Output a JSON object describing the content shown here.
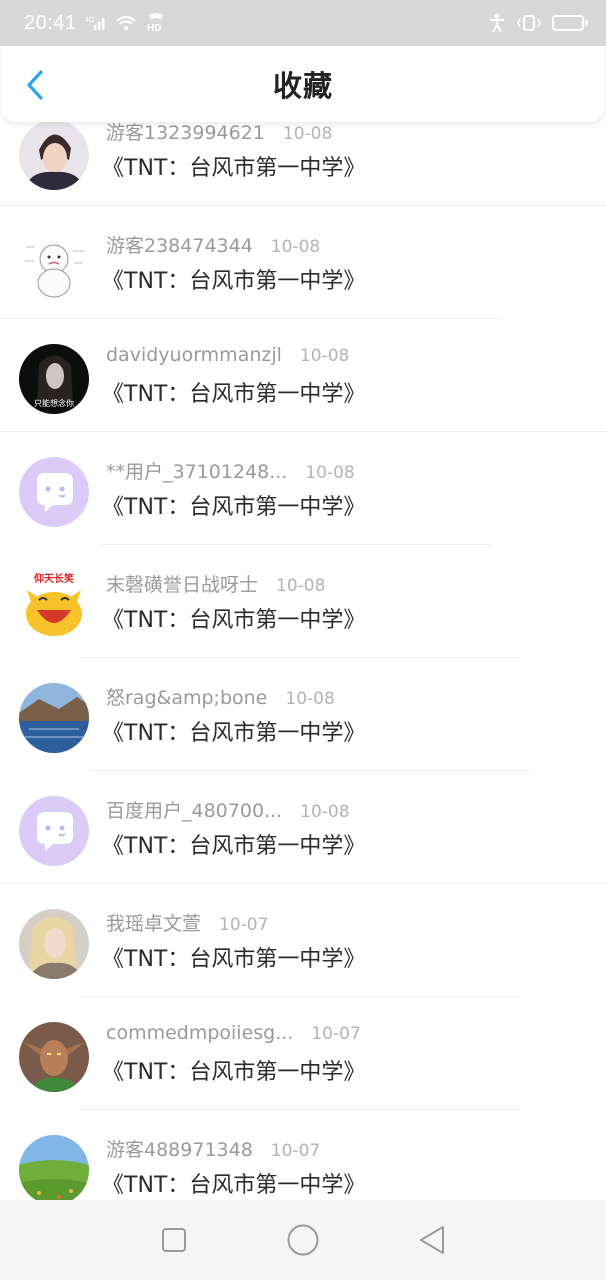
{
  "status_bar": {
    "time": "20:41",
    "net_label": "4G",
    "hd_label": "HD"
  },
  "header": {
    "title": "收藏"
  },
  "items": [
    {
      "username": "游客1323994621",
      "date": "10-08",
      "book": "《TNT：台风市第一中学》",
      "avatar": "avatar-man-hoodie"
    },
    {
      "username": "游客238474344",
      "date": "10-08",
      "book": "《TNT：台风市第一中学》",
      "avatar": "avatar-snowman"
    },
    {
      "username": "davidyuormmanzjl",
      "date": "10-08",
      "book": "《TNT：台风市第一中学》",
      "avatar": "avatar-dark-girl",
      "avatar_text": "只能想念你"
    },
    {
      "username": "**用户_37101248...",
      "date": "10-08",
      "book": "《TNT：台风市第一中学》",
      "avatar": "avatar-default-chat"
    },
    {
      "username": "末磬磺誉日战呀士",
      "date": "10-08",
      "book": "《TNT：台风市第一中学》",
      "avatar": "avatar-laughing-cat",
      "avatar_text": "仰天长笑"
    },
    {
      "username": "怒rag&amp;bone",
      "date": "10-08",
      "book": "《TNT：台风市第一中学》",
      "avatar": "avatar-lake"
    },
    {
      "username": "百度用户_480700...",
      "date": "10-08",
      "book": "《TNT：台风市第一中学》",
      "avatar": "avatar-default-chat"
    },
    {
      "username": "我瑶卓文萱",
      "date": "10-07",
      "book": "《TNT：台风市第一中学》",
      "avatar": "avatar-blonde"
    },
    {
      "username": "commedmpoiiesg...",
      "date": "10-07",
      "book": "《TNT：台风市第一中学》",
      "avatar": "avatar-orc"
    },
    {
      "username": "游客488971348",
      "date": "10-07",
      "book": "《TNT：台风市第一中学》",
      "avatar": "avatar-grassland"
    }
  ],
  "colors": {
    "accent": "#2aa5e8",
    "default_avatar": "#d9c8f5"
  }
}
